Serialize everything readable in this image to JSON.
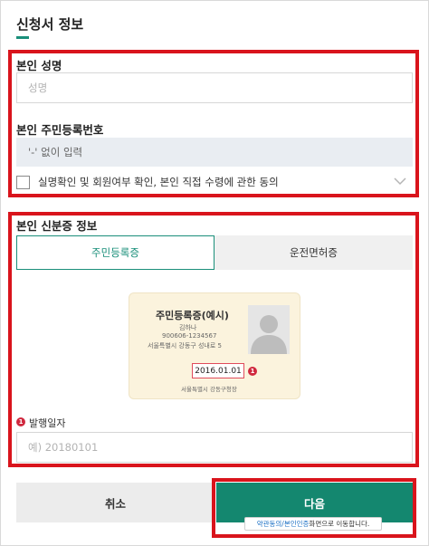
{
  "header": {
    "title": "신청서 정보"
  },
  "personal": {
    "name_label": "본인 성명",
    "name_placeholder": "성명",
    "rrn_label": "본인 주민등록번호",
    "rrn_placeholder": "'-' 없이 입력",
    "consent_text": "실명확인 및 회원여부 확인, 본인 직접 수령에 관한 동의"
  },
  "id_info": {
    "label": "본인 신분증 정보",
    "tabs": [
      "주민등록증",
      "운전면허증"
    ],
    "selected_tab": "주민등록증",
    "card": {
      "title": "주민등록증(예시)",
      "name": "김하나",
      "number": "900606-1234567",
      "address": "서울특별시 강동구 성내로 5",
      "issue_date": "2016.01.01",
      "issuer": "서울특별시 강동구청장",
      "marker": "1"
    },
    "issue_date_label": "발행일자",
    "issue_date_marker": "1",
    "issue_date_placeholder": "예) 20180101"
  },
  "buttons": {
    "cancel": "취소",
    "next": "다음"
  },
  "tooltip": {
    "accent": "약관동의/본인인증",
    "rest": " 화면으로 이동합니다."
  },
  "colors": {
    "accent": "#1a8f7a",
    "next_button": "#14876f",
    "highlight": "#d9141c",
    "marker": "#d0283e"
  }
}
